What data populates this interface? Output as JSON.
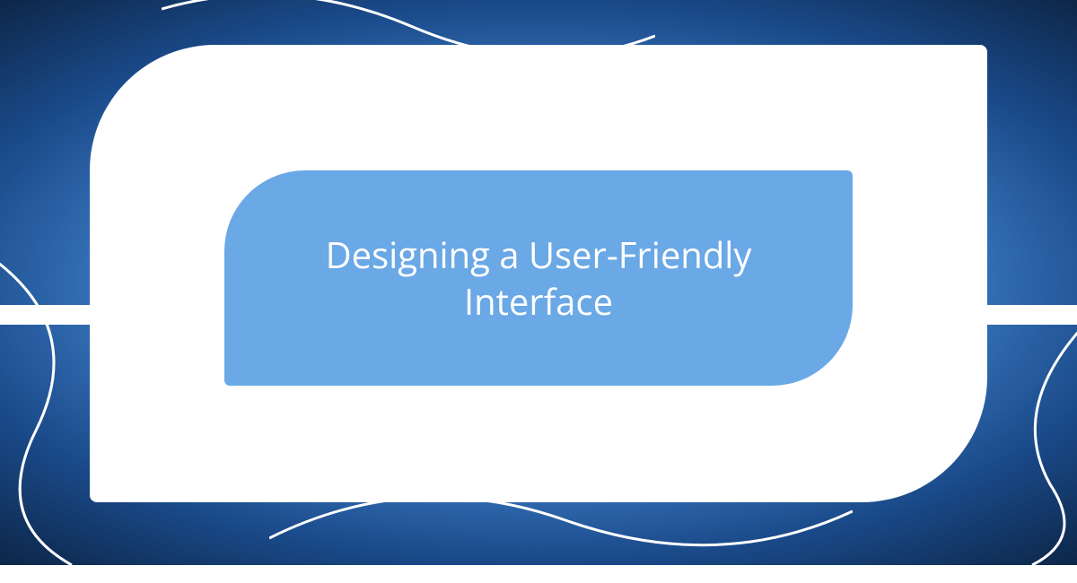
{
  "title": "Designing a User-Friendly Interface",
  "colors": {
    "innerBlue": "#6aa8e6",
    "white": "#ffffff",
    "bgDark": "#0a1f3a",
    "bgMid": "#1a4a8a",
    "bgLight": "#6ca9e8"
  }
}
